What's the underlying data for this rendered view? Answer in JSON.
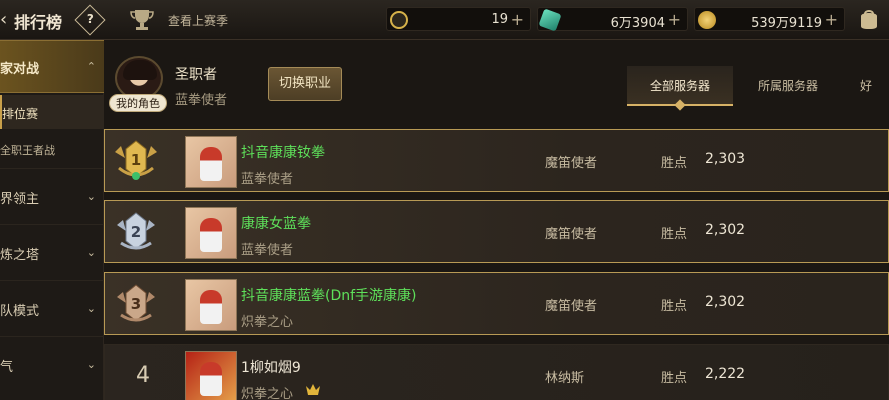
{
  "header": {
    "back_icon": "back-chevron-icon",
    "title": "排行榜",
    "help_icon": "help-diamond-icon",
    "help_glyph": "?",
    "season_icon": "trophy-icon",
    "season_link": "查看上赛季",
    "currencies": [
      {
        "icon": "c-coin-icon",
        "value": "19",
        "plus": "+",
        "color": "#d6b24a"
      },
      {
        "icon": "crystal-icon",
        "value": "6万3904",
        "plus": "+",
        "color": "#3fb99b"
      },
      {
        "icon": "gold-coin-icon",
        "value": "539万9119",
        "plus": "+",
        "color": "#e2b53b"
      }
    ],
    "bag_icon": "bag-icon"
  },
  "sidebar": {
    "section": {
      "label": "家对战",
      "chevron": "⌃"
    },
    "sub_items": [
      {
        "label": "排位赛"
      },
      {
        "label": "全职王者战"
      }
    ],
    "items": [
      {
        "label": "界领主",
        "chevron": "⌄"
      },
      {
        "label": "炼之塔",
        "chevron": "⌄"
      },
      {
        "label": "队模式",
        "chevron": "⌄"
      },
      {
        "label": "气",
        "chevron": "⌄"
      }
    ]
  },
  "profile": {
    "title": "圣职者",
    "class": "蓝拳使者",
    "badge": "我的角色",
    "switch_button": "切换职业"
  },
  "tabs": [
    {
      "label": "全部服务器",
      "active": true
    },
    {
      "label": "所属服务器",
      "active": false
    },
    {
      "label": "好",
      "active": false
    }
  ],
  "rankings": [
    {
      "rank": "1",
      "name": "抖音康康钕拳",
      "class": "蓝拳使者",
      "server": "魔笛使者",
      "wins_label": "胜点",
      "wins": "2,303",
      "name_color": "green"
    },
    {
      "rank": "2",
      "name": "康康女蓝拳",
      "class": "蓝拳使者",
      "server": "魔笛使者",
      "wins_label": "胜点",
      "wins": "2,302",
      "name_color": "green"
    },
    {
      "rank": "3",
      "name": "抖音康康蓝拳(Dnf手游康康)",
      "class": "炽拳之心",
      "server": "魔笛使者",
      "wins_label": "胜点",
      "wins": "2,302",
      "name_color": "green"
    },
    {
      "rank": "4",
      "name": "1柳如烟9",
      "class": "炽拳之心",
      "server": "林纳斯",
      "wins_label": "胜点",
      "wins": "2,222",
      "name_color": "white"
    }
  ]
}
